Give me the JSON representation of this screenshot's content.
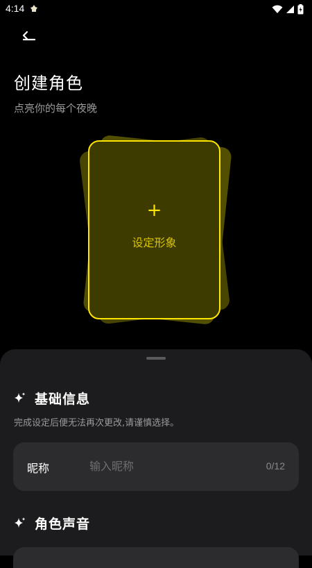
{
  "status_bar": {
    "time": "4:14",
    "icons": [
      "app-notification-icon",
      "wifi-icon",
      "signal-icon",
      "battery-icon"
    ]
  },
  "header": {
    "back_icon": "back-arrow-icon",
    "title": "创建角色",
    "subtitle": "点亮你的每个夜晚"
  },
  "avatar_card": {
    "plus_symbol": "+",
    "label": "设定形象"
  },
  "basic_info": {
    "title": "基础信息",
    "description": "完成设定后便无法再次更改,请谨慎选择。",
    "nickname": {
      "label": "昵称",
      "value": "",
      "placeholder": "输入昵称",
      "counter": "0/12"
    }
  },
  "voice": {
    "title": "角色声音"
  },
  "colors": {
    "accent": "#ffe600",
    "background": "#000000",
    "sheet": "#1c1c1e",
    "field": "#2c2c2e"
  }
}
